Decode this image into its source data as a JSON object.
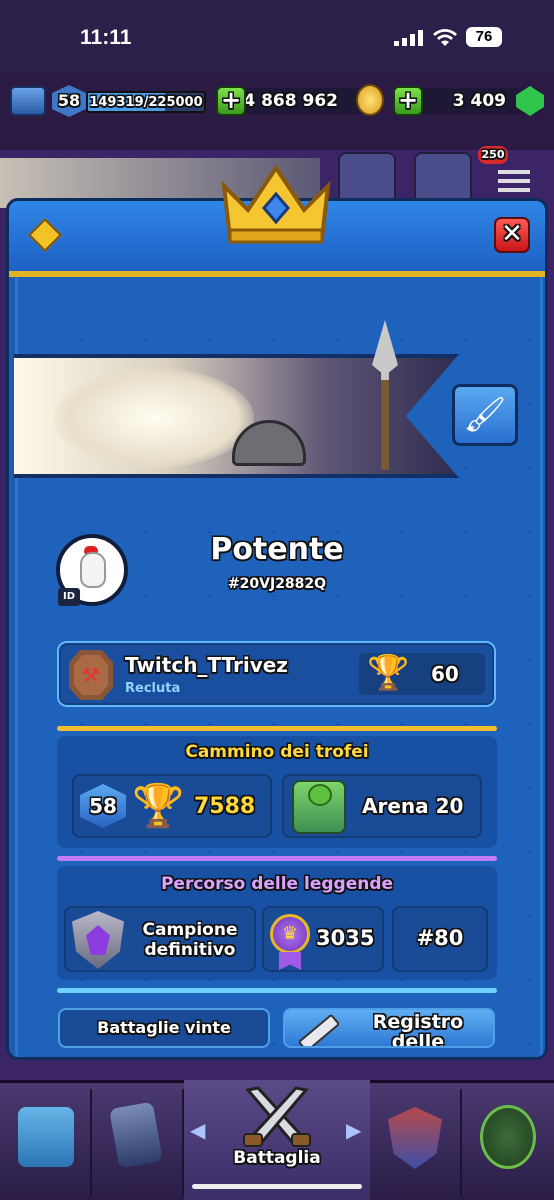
{
  "status_bar": {
    "time": "11:11",
    "battery": "76"
  },
  "resources": {
    "level": "58",
    "xp": "149319/225000",
    "xp_fraction": 0.664,
    "gold": "4 868 962",
    "gems": "3 409"
  },
  "top_badge": "250",
  "profile": {
    "name": "Potente",
    "tag": "#20VJ2882Q",
    "id_label": "ID"
  },
  "clan": {
    "name": "Twitch_TTrivez",
    "role": "Recluta",
    "trophies": "60"
  },
  "trophy_road": {
    "title": "Cammino dei trofei",
    "level": "58",
    "trophies": "7588",
    "arena": "Arena 20"
  },
  "legends_path": {
    "title": "Percorso delle leggende",
    "league": "Campione definitivo",
    "rating": "3035",
    "rank": "#80"
  },
  "stats": {
    "battles_won_label": "Battaglie vinte",
    "battle_log_label": "Registro delle"
  },
  "nav": {
    "battle_label": "Battaglia"
  },
  "colors": {
    "panel_blue": "#1d5cae",
    "gold_trim": "#e2b423",
    "trophy_text": "#ffd93b",
    "legends_purple": "#c27af5"
  }
}
